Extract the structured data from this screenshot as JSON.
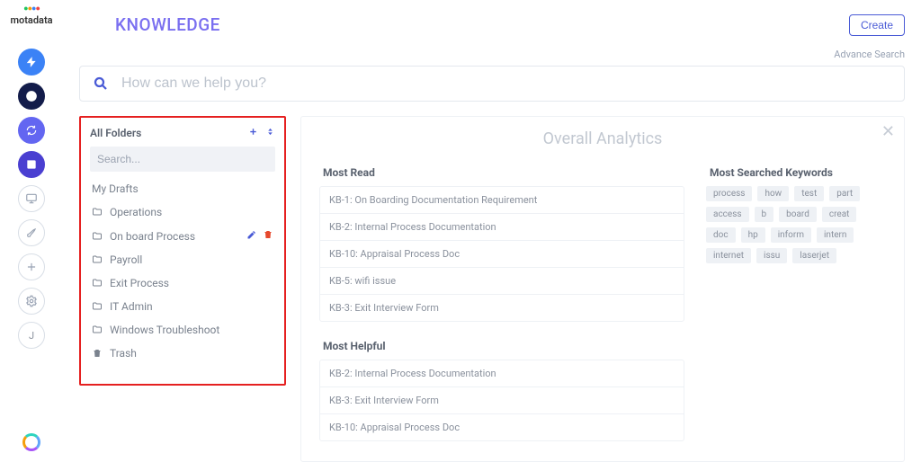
{
  "brand": "motadata",
  "pageTitle": "KNOWLEDGE",
  "createLabel": "Create",
  "advanceSearch": "Advance Search",
  "searchPlaceholder": "How can we help you?",
  "folders": {
    "header": "All Folders",
    "searchPlaceholder": "Search...",
    "myDrafts": "My Drafts",
    "trash": "Trash",
    "items": [
      {
        "label": "Operations"
      },
      {
        "label": "On board Process",
        "actions": true
      },
      {
        "label": "Payroll"
      },
      {
        "label": "Exit Process"
      },
      {
        "label": "IT Admin"
      },
      {
        "label": "Windows Troubleshoot"
      }
    ]
  },
  "analytics": {
    "title": "Overall Analytics",
    "mostRead": {
      "title": "Most Read",
      "items": [
        "KB-1: On Boarding Documentation Requirement",
        "KB-2: Internal Process Documentation",
        "KB-10: Appraisal Process Doc",
        "KB-5: wifi issue",
        "KB-3: Exit Interview Form"
      ]
    },
    "mostHelpful": {
      "title": "Most Helpful",
      "items": [
        "KB-2: Internal Process Documentation",
        "KB-3: Exit Interview Form",
        "KB-10: Appraisal Process Doc"
      ]
    },
    "keywords": {
      "title": "Most Searched Keywords",
      "items": [
        "process",
        "how",
        "test",
        "part",
        "access",
        "b",
        "board",
        "creat",
        "doc",
        "hp",
        "inform",
        "intern",
        "internet",
        "issu",
        "laserjet"
      ]
    }
  }
}
